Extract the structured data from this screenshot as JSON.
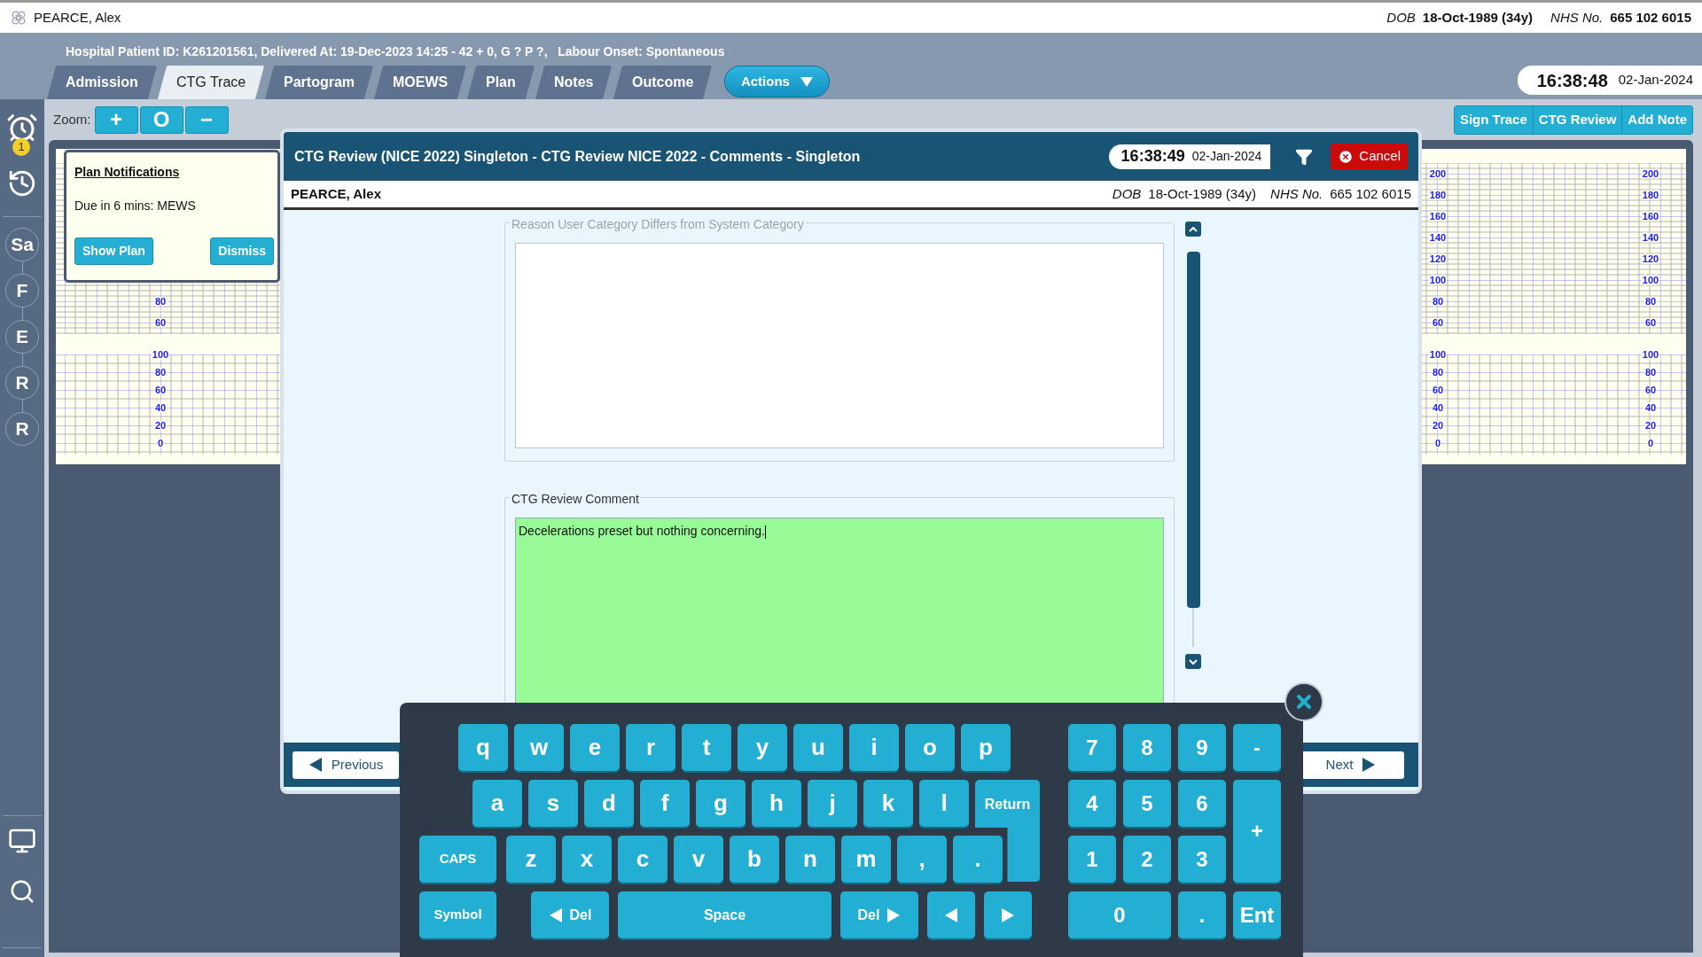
{
  "topbar": {
    "name": "PEARCE, Alex",
    "dob_label": "DOB",
    "dob": "18-Oct-1989 (34y)",
    "nhs_label": "NHS No.",
    "nhs": "665 102 6015"
  },
  "header": {
    "info": "Hospital Patient ID: K261201561, Delivered At: 19-Dec-2023 14:25 - 42 + 0, G ? P ?,   Labour Onset: Spontaneous",
    "tabs": [
      {
        "label": "Admission",
        "selected": false
      },
      {
        "label": "CTG Trace",
        "selected": true
      },
      {
        "label": "Partogram",
        "selected": false
      },
      {
        "label": "MOEWS",
        "selected": false
      },
      {
        "label": "Plan",
        "selected": false
      },
      {
        "label": "Notes",
        "selected": false
      },
      {
        "label": "Outcome",
        "selected": false
      }
    ],
    "actions": "Actions",
    "time": "16:38:48",
    "date": "02-Jan-2024"
  },
  "sidebar": {
    "alarm_badge": "1",
    "stages": [
      "Sa",
      "F",
      "E",
      "R",
      "R"
    ]
  },
  "zoom": {
    "label": "Zoom:",
    "buttons": [
      "+",
      "O",
      "−"
    ]
  },
  "trace_buttons": [
    "Sign Trace",
    "CTG Review",
    "Add Note"
  ],
  "trace": {
    "columns": [
      {
        "fhr": [
          "80",
          "60"
        ],
        "toco": [
          "100",
          "80",
          "60",
          "40",
          "20",
          "0"
        ]
      },
      {
        "fhr": [
          "200",
          "180",
          "160",
          "140",
          "120",
          "100",
          "80",
          "60"
        ],
        "toco": [
          "100",
          "80",
          "60",
          "40",
          "20",
          "0"
        ]
      },
      {
        "fhr": [
          "200",
          "180",
          "160",
          "140",
          "120",
          "100",
          "80",
          "60"
        ],
        "toco": [
          "100",
          "80",
          "60",
          "40",
          "20",
          "0"
        ]
      }
    ]
  },
  "notification": {
    "title": "Plan Notifications",
    "message": "Due in 6 mins: MEWS",
    "buttons": [
      "Show Plan",
      "Dismiss"
    ]
  },
  "dialog": {
    "title": "CTG Review (NICE 2022) Singleton - CTG Review NICE 2022 - Comments - Singleton",
    "time": "16:38:49",
    "date": "02-Jan-2024",
    "cancel": "Cancel",
    "patient": {
      "name": "PEARCE, Alex",
      "dob_label": "DOB",
      "dob": "18-Oct-1989 (34y)",
      "nhs_label": "NHS No.",
      "nhs": "665 102 6015"
    },
    "fields": [
      {
        "legend": "Reason User Category Differs from System Category",
        "disabled": true,
        "focused": false
      },
      {
        "legend": "CTG Review Comment",
        "value": "Decelerations preset but nothing concerning.",
        "disabled": false,
        "focused": true
      }
    ],
    "previous": "Previous",
    "next": "Next"
  },
  "keyboard": {
    "letters": [
      [
        "q",
        "w",
        "e",
        "r",
        "t",
        "y",
        "u",
        "i",
        "o",
        "p"
      ],
      [
        "a",
        "s",
        "d",
        "f",
        "g",
        "h",
        "j",
        "k",
        "l"
      ],
      [
        "z",
        "x",
        "c",
        "v",
        "b",
        "n",
        "m",
        ",",
        "."
      ]
    ],
    "return": "Return",
    "caps": "CAPS",
    "bottom": [
      {
        "kind": "symbol",
        "label": "Symbol"
      },
      {
        "kind": "del-left",
        "label": "Del"
      },
      {
        "kind": "space",
        "label": "Space"
      },
      {
        "kind": "del-right",
        "label": "Del"
      },
      {
        "kind": "left"
      },
      {
        "kind": "right"
      }
    ],
    "numpad": [
      "7",
      "8",
      "9",
      "-",
      "4",
      "5",
      "6",
      "+",
      "1",
      "2",
      "3",
      "0",
      ".",
      "Ent"
    ]
  }
}
